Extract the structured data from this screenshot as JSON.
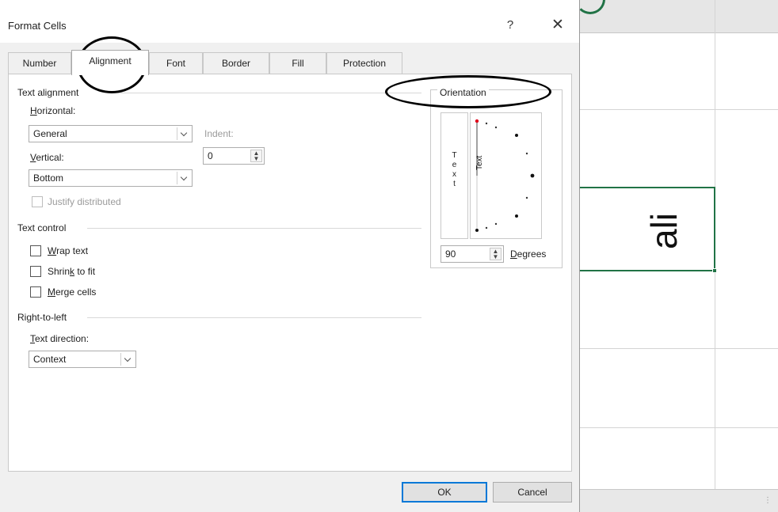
{
  "dialog": {
    "title": "Format Cells",
    "help_label": "?",
    "close_label": "✕",
    "tabs": [
      {
        "label": "Number",
        "active": false
      },
      {
        "label": "Alignment",
        "active": true
      },
      {
        "label": "Font",
        "active": false
      },
      {
        "label": "Border",
        "active": false
      },
      {
        "label": "Fill",
        "active": false
      },
      {
        "label": "Protection",
        "active": false
      }
    ]
  },
  "text_alignment": {
    "section_label": "Text alignment",
    "horizontal": {
      "key": "H",
      "rest": "orizontal:",
      "value": "General"
    },
    "indent": {
      "label": "Indent:",
      "value": "0"
    },
    "vertical": {
      "key": "V",
      "rest": "ertical:",
      "value": "Bottom"
    },
    "justify_distributed": {
      "label": "Justify distributed",
      "checked": false,
      "enabled": false
    }
  },
  "text_control": {
    "section_label": "Text control",
    "wrap_text": {
      "key": "W",
      "rest": "rap text",
      "checked": false
    },
    "shrink_to_fit": {
      "pre": "Shrin",
      "key": "k",
      "rest": " to fit",
      "checked": false
    },
    "merge_cells": {
      "key": "M",
      "rest": "erge cells",
      "checked": false
    }
  },
  "right_to_left": {
    "section_label": "Right-to-left",
    "text_direction": {
      "key": "T",
      "rest": "ext direction:",
      "value": "Context"
    }
  },
  "orientation": {
    "section_label": "Orientation",
    "vertical_text_letters": [
      "T",
      "e",
      "x",
      "t"
    ],
    "dial_text": "Text",
    "degrees_value": "90",
    "degrees_label": {
      "key": "D",
      "rest": "egrees"
    },
    "degrees_numeric": 90
  },
  "buttons": {
    "ok_label": "OK",
    "cancel_label": "Cancel"
  },
  "sheet": {
    "cell_text": "ali"
  },
  "colors": {
    "excel_green": "#217346",
    "focus_blue": "#0078d7",
    "dial_marker_red": "#e0001a"
  }
}
